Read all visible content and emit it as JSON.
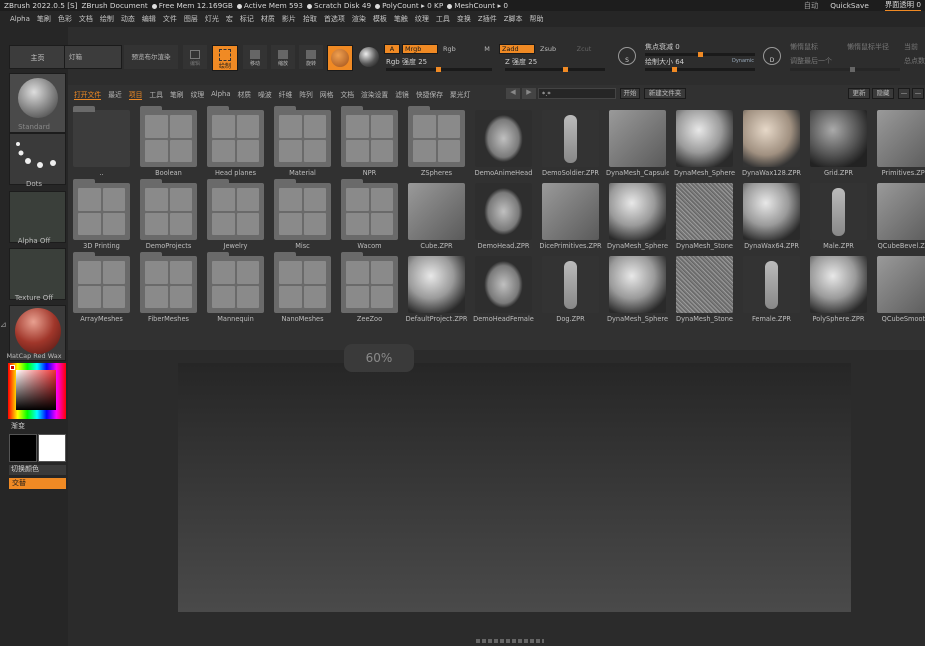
{
  "titlebar": {
    "app": "ZBrush 2022.0.5 [S]",
    "doc": "ZBrush Document",
    "free_mem": "Free Mem 12.169GB",
    "active_mem": "Active Mem 593",
    "scratch": "Scratch Disk 49",
    "polycount": "PolyCount ▸ 0 KP",
    "meshcount": "MeshCount ▸ 0",
    "auto": "自动",
    "quicksave": "QuickSave",
    "ui_transparency": "界面透明 0"
  },
  "menu": [
    "Alpha",
    "笔刷",
    "色彩",
    "文档",
    "绘制",
    "动态",
    "编辑",
    "文件",
    "图层",
    "灯光",
    "宏",
    "标记",
    "材质",
    "影片",
    "拾取",
    "首选项",
    "渲染",
    "模板",
    "笔触",
    "纹理",
    "工具",
    "变换",
    "Z插件",
    "Z脚本",
    "帮助"
  ],
  "left": {
    "home": "主页",
    "brush_label": "Standard",
    "stroke_label": "Dots",
    "alpha_label": "Alpha Off",
    "texture_label": "Texture Off",
    "material_label": "MatCap Red Wax",
    "gradient_label": "渐变",
    "swap_label": "切换颜色",
    "alternate_label": "交替"
  },
  "shelf": {
    "lightbox": "灯箱",
    "boolean": "预览布尔渲染",
    "edit": "编辑",
    "draw": "绘制",
    "move": "移动",
    "scale": "缩放",
    "rotate": "旋转",
    "A": "A",
    "mrgb": "Mrgb",
    "rgb": "Rgb",
    "m": "M",
    "zadd": "Zadd",
    "zsub": "Zsub",
    "zcut": "Zcut",
    "rgb_intensity": "Rgb 强度 25",
    "z_intensity": "Z 强度 25",
    "focal": "焦点衰减 0",
    "draw_size": "绘制大小 64",
    "dynamic": "Dynamic",
    "lazy_mouse": "懒惰鼠标",
    "lazy_radius": "懒惰鼠标半径",
    "lazy_step": "调整最后一个",
    "current": "当前",
    "total": "总点数"
  },
  "lightbox": {
    "tabs": [
      "打开文件",
      "最近",
      "项目",
      "工具",
      "笔刷",
      "纹理",
      "Alpha",
      "材质",
      "噪波",
      "纤维",
      "阵列",
      "网格",
      "文档",
      "渲染设置",
      "滤镜",
      "快捷保存",
      "聚光灯"
    ],
    "active_tab": "项目",
    "search_value": "*.*",
    "open_btn": "开始",
    "new_folder": "新建文件夹",
    "update": "更新",
    "hide": "隐藏",
    "row1": [
      "..",
      "Boolean",
      "Head planes",
      "Material",
      "NPR",
      "ZSpheres",
      "DemoAnimeHead",
      "DemoSoldier.ZPR",
      "DynaMesh_Capsule",
      "DynaMesh_Sphere",
      "DynaWax128.ZPR",
      "Grid.ZPR",
      "Primitives.ZPR"
    ],
    "row2": [
      "3D Printing",
      "DemoProjects",
      "Jewelry",
      "Misc",
      "Wacom",
      "Cube.ZPR",
      "DemoHead.ZPR",
      "DicePrimitives.ZPR",
      "DynaMesh_Sphere",
      "DynaMesh_Stone",
      "DynaWax64.ZPR",
      "Male.ZPR",
      "QCubeBevel.ZPR"
    ],
    "row3": [
      "ArrayMeshes",
      "FiberMeshes",
      "Mannequin",
      "NanoMeshes",
      "ZeeZoo",
      "DefaultProject.ZPR",
      "DemoHeadFemale",
      "Dog.ZPR",
      "DynaMesh_Sphere",
      "DynaMesh_Stone",
      "Female.ZPR",
      "PolySphere.ZPR",
      "QCubeSmooth"
    ]
  },
  "canvas": {
    "percent": "60%"
  }
}
